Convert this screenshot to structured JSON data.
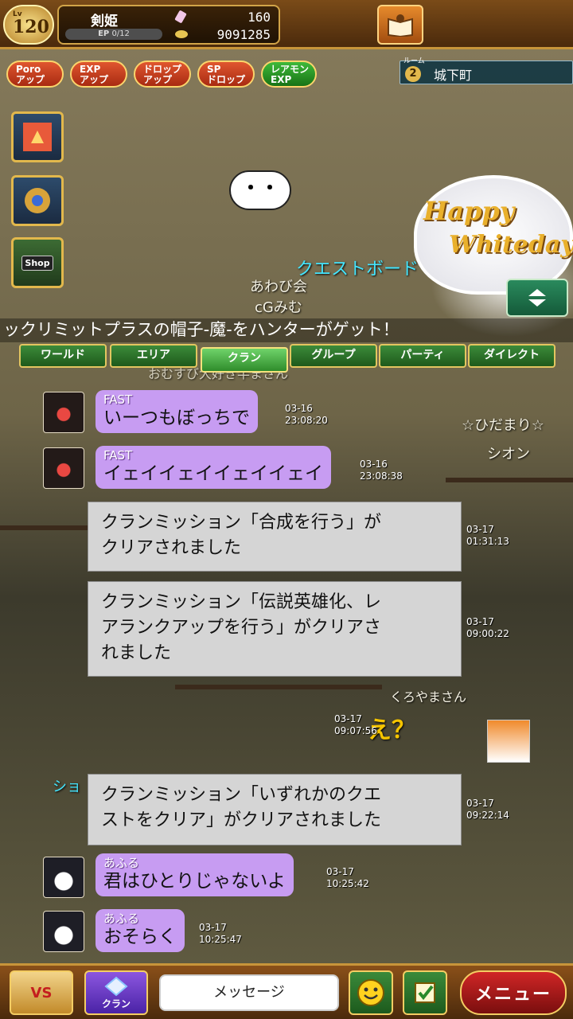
{
  "player": {
    "level_label": "Lv",
    "level": "120",
    "name": "剣姫",
    "ep_label": "EP",
    "ep_value": "0/12",
    "gems": "160",
    "coins": "9091285"
  },
  "boosts": [
    {
      "label": "Poro\nアップ",
      "color": "#d94a2a"
    },
    {
      "label": "EXP\nアップ",
      "color": "#d94a2a"
    },
    {
      "label": "ドロップ\nアップ",
      "color": "#d94a2a"
    },
    {
      "label": "SP\nドロップ",
      "color": "#d94a2a"
    },
    {
      "label": "レアモン\nEXP",
      "color": "#2f9a2c"
    }
  ],
  "room": {
    "label": "ルーム",
    "number": "2",
    "name": "城下町"
  },
  "side_buttons": {
    "shop": "Shop"
  },
  "scene": {
    "speech": "・・",
    "quest_board": "クエストボード",
    "happy_line1": "Happy",
    "happy_line2": "Whiteday",
    "player_awabi": "あわび会",
    "player_cg": "cGみむ",
    "player_hidamari": "☆ひだまり☆",
    "player_shion": "シオン",
    "player_kuroyama": "くろやまさん",
    "emote": "え？",
    "overlapped_text": "おむすび大好き半まさん",
    "sho": "ショ"
  },
  "ticker": "ックリミットプラスの帽子-魔-をハンターがゲット！",
  "tabs": [
    "ワールド",
    "エリア",
    "クラン",
    "グループ",
    "パーティ",
    "ダイレクト"
  ],
  "active_tab": "クラン",
  "chat": {
    "m1": {
      "sender": "FAST",
      "text": "いーつもぼっちで",
      "date": "03-16",
      "time": "23:08:20"
    },
    "m2": {
      "sender": "FAST",
      "text": "イェイイェイイェイイェイ",
      "date": "03-16",
      "time": "23:08:38"
    },
    "s1": {
      "line1": "クランミッション「合成を行う」が",
      "line2": "クリアされました",
      "date": "03-17",
      "time": "01:31:13"
    },
    "s2": {
      "line1": "クランミッション「伝説英雄化、レ",
      "line2": "アランクアップを行う」がクリアさ",
      "line3": "れました",
      "date": "03-17",
      "time": "09:00:22"
    },
    "ts1": {
      "date": "03-17",
      "time": "09:07:56"
    },
    "s3": {
      "line1": "クランミッション「いずれかのクエ",
      "line2": "ストをクリア」がクリアされました",
      "date": "03-17",
      "time": "09:22:14"
    },
    "m3": {
      "sender": "あふる",
      "text": "君はひとりじゃないよ",
      "date": "03-17",
      "time": "10:25:42"
    },
    "m4": {
      "sender": "あふる",
      "text": "おそらく",
      "date": "03-17",
      "time": "10:25:47"
    }
  },
  "bottom": {
    "vs": "VS",
    "clan": "クラン",
    "message_placeholder": "メッセージ",
    "menu": "メニュー"
  },
  "colors": {
    "bubble": "#c79cf2",
    "system": "#d5d5d5",
    "accent": "#e2b84c"
  }
}
